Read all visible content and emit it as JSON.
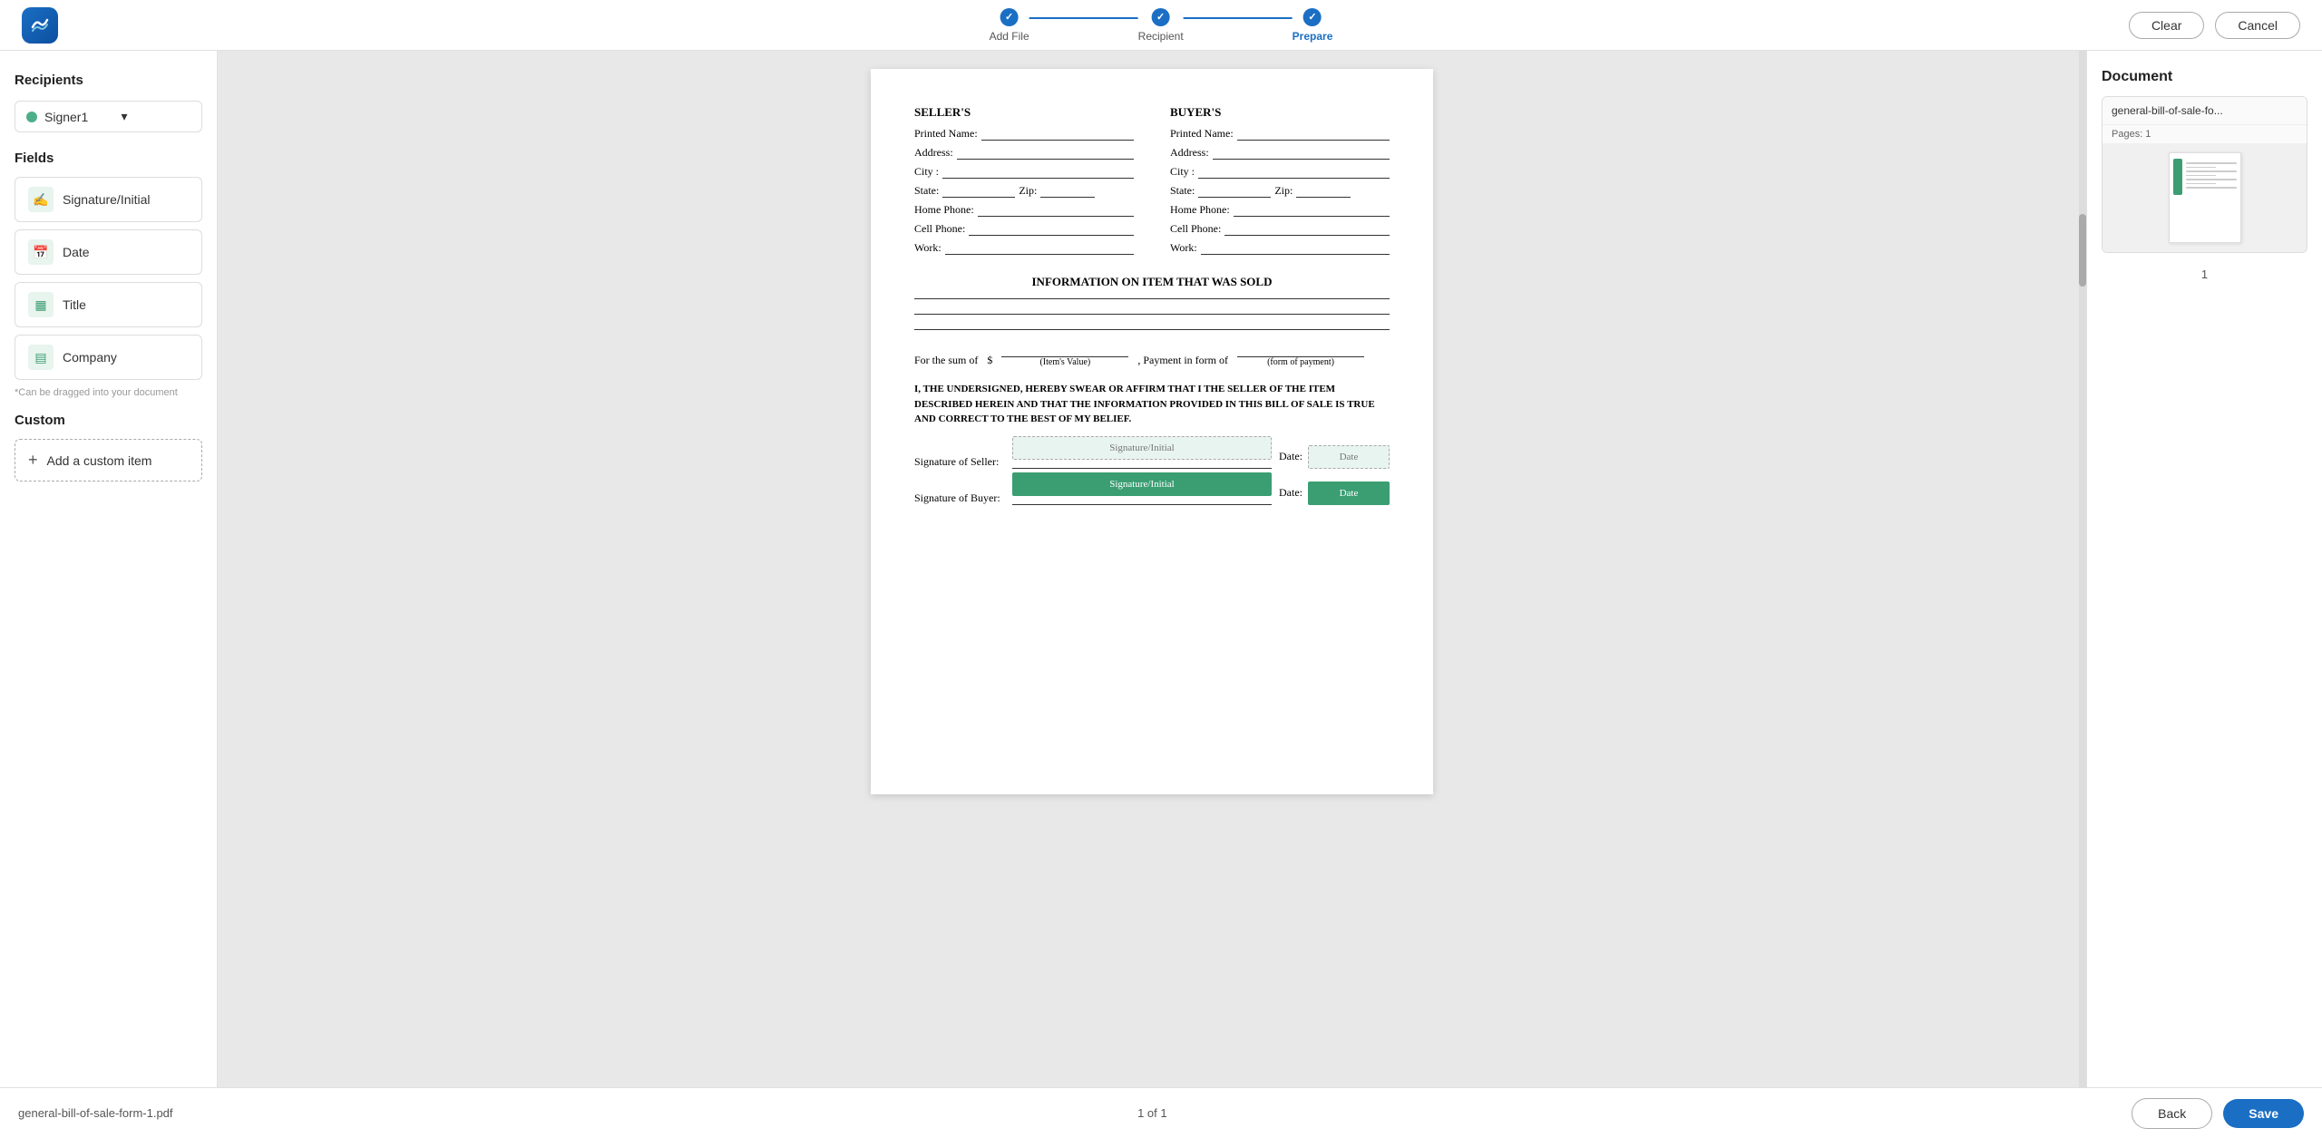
{
  "app": {
    "logo_alt": "App Logo"
  },
  "stepper": {
    "steps": [
      {
        "id": "add-file",
        "label": "Add File",
        "state": "done"
      },
      {
        "id": "recipient",
        "label": "Recipient",
        "state": "done"
      },
      {
        "id": "prepare",
        "label": "Prepare",
        "state": "active"
      }
    ],
    "line1_state": "done",
    "line2_state": "done"
  },
  "nav": {
    "clear_label": "Clear",
    "cancel_label": "Cancel"
  },
  "sidebar": {
    "recipients_title": "Recipients",
    "signer_name": "Signer1",
    "fields_title": "Fields",
    "fields": [
      {
        "id": "signature-initial",
        "label": "Signature/Initial",
        "type": "sig"
      },
      {
        "id": "date",
        "label": "Date",
        "type": "date"
      },
      {
        "id": "title",
        "label": "Title",
        "type": "title"
      },
      {
        "id": "company",
        "label": "Company",
        "type": "company"
      }
    ],
    "drag_hint": "*Can be dragged into your document",
    "custom_title": "Custom",
    "add_custom_label": "Add a custom item"
  },
  "document": {
    "seller_header": "SELLER'S",
    "buyer_header": "BUYER'S",
    "printed_name_label": "Printed Name:",
    "address_label": "Address:",
    "city_label": "City :",
    "state_label": "State:",
    "zip_label": "Zip:",
    "home_phone_label": "Home Phone:",
    "cell_phone_label": "Cell Phone:",
    "work_label": "Work:",
    "info_title": "INFORMATION ON ITEM THAT WAS SOLD",
    "for_sum_label": "For the sum of",
    "dollar_sign": "$",
    "items_value_label": "(Item's Value)",
    "payment_form_label": ", Payment in form of",
    "form_of_payment_label": "(form of payment)",
    "affirmation": "I, THE UNDERSIGNED, HEREBY SWEAR OR AFFIRM THAT I THE SELLER OF THE ITEM DESCRIBED HEREIN AND THAT THE INFORMATION PROVIDED IN THIS BILL OF SALE IS TRUE AND CORRECT TO THE BEST OF MY BELIEF.",
    "sig_seller_label": "Signature of Seller:",
    "sig_buyer_label": "Signature of Buyer:",
    "date_label": "Date:",
    "sig_placeholder": "Signature/Initial",
    "date_placeholder": "Date"
  },
  "right_panel": {
    "title": "Document",
    "doc_name": "general-bill-of-sale-fo...",
    "pages_label": "Pages: 1",
    "page_number": "1"
  },
  "footer_bar": {
    "filename": "general-bill-of-sale-form-1.pdf",
    "page_info": "1 of 1"
  },
  "bottom_actions": {
    "back_label": "Back",
    "save_label": "Save"
  }
}
